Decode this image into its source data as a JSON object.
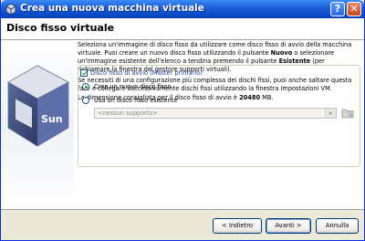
{
  "window": {
    "title": "Crea una nuova macchina virtuale"
  },
  "titlebar": {
    "help_label": "?",
    "close_label": "✕"
  },
  "header": {
    "title": "Disco fisso virtuale"
  },
  "description": {
    "p1_a": "Seleziona un'immagine di disco fisso da utilizzare come disco fisso di avvio della macchina virtuale. Puoi creare un nuovo disco fisso utilizzando il pulsante ",
    "p1_b": "Nuovo",
    "p1_c": " o selezionare un'immagine esistente dell'elenco a tendina premendo il pulsante ",
    "p1_d": "Esistente",
    "p1_e": " (per richiamare la finestra del gestore supporti virtuali).",
    "p2": "Se necessiti di una configurazione più complessa dei dischi fissi, puoi anche saltare questa fase e collegare successivamente dischi fissi utilizzando la finestra Impostazioni VM.",
    "p3_a": "La dimensione consigliata per il disco fisso di avvio è ",
    "p3_b": "20480",
    "p3_c": " MB."
  },
  "boot_disk": {
    "checkbox_label": "Disco fisso di avvio (Master primario)",
    "checked": true,
    "options": [
      "Crea un nuovo disco fisso",
      "Usa un disco fisso esistente"
    ],
    "selected_option": 0,
    "select_value": "<nessun supporto>"
  },
  "icons": {
    "title_icon": "virtualbox-icon",
    "folder_icon": "folder-icon",
    "logo": "virtualbox-sun-logo",
    "logo_text": "Sun"
  },
  "buttons": {
    "back": "< Indietro",
    "next": "Avanti >",
    "cancel": "Annulla"
  }
}
